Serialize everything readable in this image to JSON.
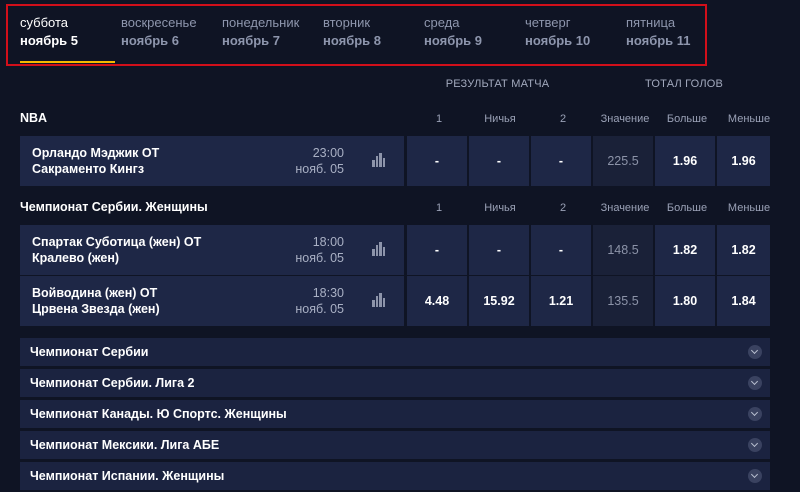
{
  "days": [
    {
      "name": "суббота",
      "date": "ноябрь 5",
      "active": true
    },
    {
      "name": "воскресенье",
      "date": "ноябрь 6"
    },
    {
      "name": "понедельник",
      "date": "ноябрь 7"
    },
    {
      "name": "вторник",
      "date": "ноябрь 8"
    },
    {
      "name": "среда",
      "date": "ноябрь 9"
    },
    {
      "name": "четверг",
      "date": "ноябрь 10"
    },
    {
      "name": "пятница",
      "date": "ноябрь 11"
    }
  ],
  "headers": {
    "match_result": "РЕЗУЛЬТАТ МАТЧА",
    "total_goals": "ТОТАЛ ГОЛОВ",
    "col_1": "1",
    "col_draw": "Ничья",
    "col_2": "2",
    "col_value": "Значение",
    "col_over": "Больше",
    "col_under": "Меньше"
  },
  "leagues": [
    {
      "name": "NBA",
      "events": [
        {
          "home": "Орландо Мэджик ОТ",
          "away": "Сакраменто Кингз",
          "time": "23:00",
          "date": "нояб. 05",
          "odd1": "-",
          "oddX": "-",
          "odd2": "-",
          "total": "225.5",
          "over": "1.96",
          "under": "1.96"
        }
      ]
    },
    {
      "name": "Чемпионат Сербии. Женщины",
      "events": [
        {
          "home": "Спартак Суботица (жен) ОТ",
          "away": "Кралево (жен)",
          "time": "18:00",
          "date": "нояб. 05",
          "odd1": "-",
          "oddX": "-",
          "odd2": "-",
          "total": "148.5",
          "over": "1.82",
          "under": "1.82"
        },
        {
          "home": "Войводина (жен) ОТ",
          "away": "Црвена Звезда (жен)",
          "time": "18:30",
          "date": "нояб. 05",
          "odd1": "4.48",
          "oddX": "15.92",
          "odd2": "1.21",
          "total": "135.5",
          "over": "1.80",
          "under": "1.84"
        }
      ]
    }
  ],
  "collapsed_leagues": [
    "Чемпионат Сербии",
    "Чемпионат Сербии. Лига 2",
    "Чемпионат Канады. Ю Спортс. Женщины",
    "Чемпионат Мексики. Лига АБЕ",
    "Чемпионат Испании. Женщины"
  ],
  "icons": {
    "stats": "bar-chart-icon",
    "expand": "chevron-down-circle-icon"
  },
  "colors": {
    "accent": "#f5b800",
    "highlight_border": "#d10f1a",
    "background": "#0f1424",
    "row": "#1e2746"
  }
}
